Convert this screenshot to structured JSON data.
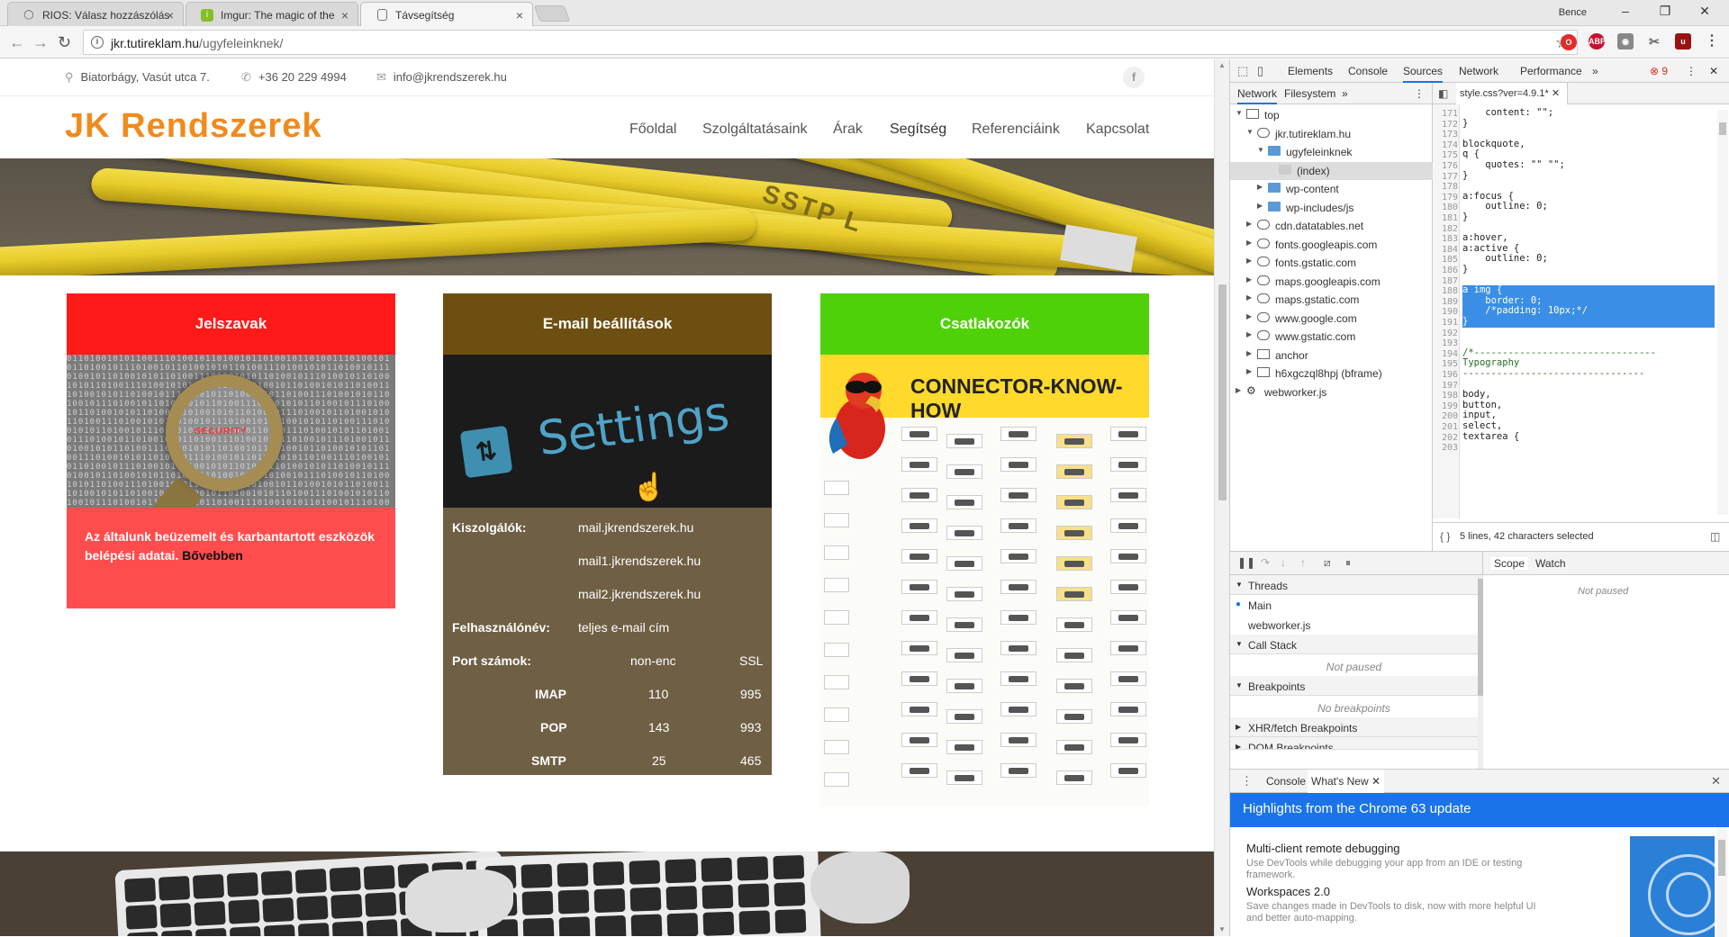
{
  "browser": {
    "tabs": [
      {
        "title": "RIOS: Válasz hozzászólás",
        "icon": "forum-icon",
        "active": false
      },
      {
        "title": "Imgur: The magic of the",
        "icon": "imgur-icon",
        "active": false
      },
      {
        "title": "Távsegítség",
        "icon": "page-icon",
        "active": true
      }
    ],
    "profile_name": "Bence",
    "url_host": "jkr.tutireklam.hu",
    "url_path": "/ugyfeleinknek/"
  },
  "site": {
    "address": "Biatorbágy, Vasút utca 7.",
    "phone": "+36 20 229 4994",
    "email": "info@jkrendszerek.hu",
    "facebook": "f",
    "logo": "JK Rendszerek",
    "nav": [
      "Főoldal",
      "Szolgáltatásaink",
      "Árak",
      "Segítség",
      "Referenciáink",
      "Kapcsolat"
    ],
    "current_nav": "Segítség",
    "hero_label": "SSTP L"
  },
  "cards": {
    "passwords": {
      "title": "Jelszavak",
      "text": "Az általunk beüzemelt és karbantartott eszközök belépési adatai.",
      "more": "Bővebben",
      "image_word": "SECURITY"
    },
    "email": {
      "title": "E-mail beállítások",
      "image_word": "Settings",
      "servers_label": "Kiszolgálók:",
      "servers": [
        "mail.jkrendszerek.hu",
        "mail1.jkrendszerek.hu",
        "mail2.jkrendszerek.hu"
      ],
      "username_label": "Felhasználónév:",
      "username_value": "teljes e-mail cím",
      "ports_label": "Port számok:",
      "col_nonenc": "non-enc",
      "col_ssl": "SSL",
      "ports": [
        {
          "proto": "IMAP",
          "nonenc": "110",
          "ssl": "995"
        },
        {
          "proto": "POP",
          "nonenc": "143",
          "ssl": "993"
        },
        {
          "proto": "SMTP",
          "nonenc": "25",
          "ssl": "465"
        }
      ]
    },
    "connectors": {
      "title": "Csatlakozók",
      "banner": "CONNECTOR-KNOW-HOW"
    }
  },
  "devtools": {
    "tabs": [
      "Elements",
      "Console",
      "Sources",
      "Network",
      "Performance"
    ],
    "active_tab": "Sources",
    "error_count": "9",
    "nav_tabs": [
      "Network",
      "Filesystem"
    ],
    "tree": [
      {
        "label": "top",
        "indent": 0,
        "type": "frame",
        "open": true
      },
      {
        "label": "jkr.tutireklam.hu",
        "indent": 1,
        "type": "cloud",
        "open": true
      },
      {
        "label": "ugyfeleinknek",
        "indent": 2,
        "type": "folder",
        "open": true
      },
      {
        "label": "(index)",
        "indent": 3,
        "type": "file",
        "selected": true
      },
      {
        "label": "wp-content",
        "indent": 2,
        "type": "folder",
        "open": false
      },
      {
        "label": "wp-includes/js",
        "indent": 2,
        "type": "folder",
        "open": false
      },
      {
        "label": "cdn.datatables.net",
        "indent": 1,
        "type": "cloud",
        "open": false
      },
      {
        "label": "fonts.googleapis.com",
        "indent": 1,
        "type": "cloud",
        "open": false
      },
      {
        "label": "fonts.gstatic.com",
        "indent": 1,
        "type": "cloud",
        "open": false
      },
      {
        "label": "maps.googleapis.com",
        "indent": 1,
        "type": "cloud",
        "open": false
      },
      {
        "label": "maps.gstatic.com",
        "indent": 1,
        "type": "cloud",
        "open": false
      },
      {
        "label": "www.google.com",
        "indent": 1,
        "type": "cloud",
        "open": false
      },
      {
        "label": "www.gstatic.com",
        "indent": 1,
        "type": "cloud",
        "open": false
      },
      {
        "label": "anchor",
        "indent": 1,
        "type": "frame",
        "open": false
      },
      {
        "label": "h6xgczql8hpj (bframe)",
        "indent": 1,
        "type": "frame",
        "open": false
      },
      {
        "label": "webworker.js",
        "indent": 0,
        "type": "gear",
        "open": false
      }
    ],
    "editor_tab": "style.css?ver=4.9.1*",
    "code": [
      {
        "n": "171",
        "t": "    content: \"\";"
      },
      {
        "n": "172",
        "t": "}"
      },
      {
        "n": "173",
        "t": ""
      },
      {
        "n": "174",
        "t": "blockquote,"
      },
      {
        "n": "175",
        "t": "q {"
      },
      {
        "n": "176",
        "t": "    quotes: \"\" \"\";"
      },
      {
        "n": "177",
        "t": "}"
      },
      {
        "n": "178",
        "t": ""
      },
      {
        "n": "179",
        "t": "a:focus {"
      },
      {
        "n": "180",
        "t": "    outline: 0;"
      },
      {
        "n": "181",
        "t": "}"
      },
      {
        "n": "182",
        "t": ""
      },
      {
        "n": "183",
        "t": "a:hover,"
      },
      {
        "n": "184",
        "t": "a:active {"
      },
      {
        "n": "185",
        "t": "    outline: 0;"
      },
      {
        "n": "186",
        "t": "}"
      },
      {
        "n": "187",
        "t": ""
      },
      {
        "n": "188",
        "t": "a img {",
        "hl": true
      },
      {
        "n": "189",
        "t": "    border: 0;",
        "hl": true
      },
      {
        "n": "190",
        "t": "    /*padding: 10px;*/",
        "hl": true
      },
      {
        "n": "191",
        "t": "}",
        "hl": true
      },
      {
        "n": "192",
        "t": ""
      },
      {
        "n": "193",
        "t": ""
      },
      {
        "n": "194",
        "t": "/*--------------------------------"
      },
      {
        "n": "195",
        "t": "Typography"
      },
      {
        "n": "196",
        "t": "--------------------------------"
      },
      {
        "n": "197",
        "t": ""
      },
      {
        "n": "198",
        "t": "body,"
      },
      {
        "n": "199",
        "t": "button,"
      },
      {
        "n": "200",
        "t": "input,"
      },
      {
        "n": "201",
        "t": "select,"
      },
      {
        "n": "202",
        "t": "textarea {"
      },
      {
        "n": "203",
        "t": ""
      }
    ],
    "selection_status": "5 lines, 42 characters selected",
    "sections": {
      "threads": "Threads",
      "threads_items": [
        "Main",
        "webworker.js"
      ],
      "call_stack": "Call Stack",
      "call_stack_empty": "Not paused",
      "breakpoints": "Breakpoints",
      "breakpoints_empty": "No breakpoints",
      "xhr": "XHR/fetch Breakpoints",
      "dom": "DOM Breakpoints"
    },
    "scope_tabs": [
      "Scope",
      "Watch"
    ],
    "scope_empty": "Not paused",
    "drawer_tabs": [
      "Console",
      "What's New"
    ],
    "whats_new_title": "Highlights from the Chrome 63 update",
    "whats_new": [
      {
        "title": "Multi-client remote debugging",
        "desc": "Use DevTools while debugging your app from an IDE or testing framework."
      },
      {
        "title": "Workspaces 2.0",
        "desc": "Save changes made in DevTools to disk, now with more helpful UI and better auto-mapping."
      }
    ]
  }
}
